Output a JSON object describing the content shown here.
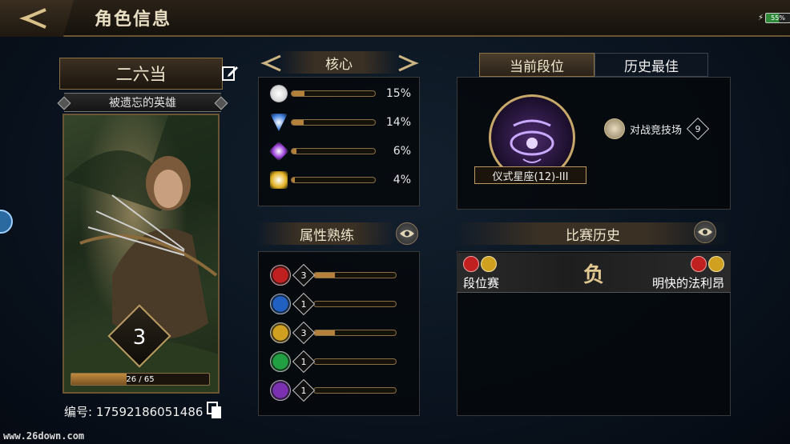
{
  "header": {
    "title": "角色信息",
    "battery": "55%"
  },
  "profile": {
    "name": "二六当",
    "subtitle": "被遗忘的英雄",
    "level": "3",
    "xp_text": "26 / 65",
    "xp_progress": 0.4,
    "id_text": "编号: 17592186051486"
  },
  "core": {
    "title": "核心",
    "stats": [
      {
        "icon": "neutral-gem-icon",
        "value": "15%",
        "progress": 0.15,
        "color": "#d8d8d8"
      },
      {
        "icon": "blue-gem-icon",
        "value": "14%",
        "progress": 0.14,
        "color": "#3a7ad8"
      },
      {
        "icon": "purple-gem-icon",
        "value": "6%",
        "progress": 0.06,
        "color": "#9a40d8"
      },
      {
        "icon": "gold-gem-icon",
        "value": "4%",
        "progress": 0.04,
        "color": "#e0b020"
      }
    ]
  },
  "mastery": {
    "title": "属性熟练",
    "items": [
      {
        "icon": "strength-icon",
        "level": "3",
        "progress": 0.25,
        "color": "#c02020"
      },
      {
        "icon": "intelligence-icon",
        "level": "1",
        "progress": 0.0,
        "color": "#2060c0"
      },
      {
        "icon": "willpower-icon",
        "level": "3",
        "progress": 0.25,
        "color": "#d0a020"
      },
      {
        "icon": "agility-icon",
        "level": "1",
        "progress": 0.0,
        "color": "#20a040"
      },
      {
        "icon": "endurance-icon",
        "level": "1",
        "progress": 0.0,
        "color": "#7a30b0"
      }
    ]
  },
  "rank": {
    "tabs": [
      {
        "label": "当前段位",
        "active": true
      },
      {
        "label": "历史最佳",
        "active": false
      }
    ],
    "rank_name": "仪式星座(12)-III",
    "arena_label": "对战竞技场",
    "arena_count": "9"
  },
  "history": {
    "title": "比赛历史",
    "matches": [
      {
        "mode": "段位赛",
        "result": "负",
        "opponent": "明快的法利昂"
      }
    ]
  },
  "watermark": "www.26down.com"
}
